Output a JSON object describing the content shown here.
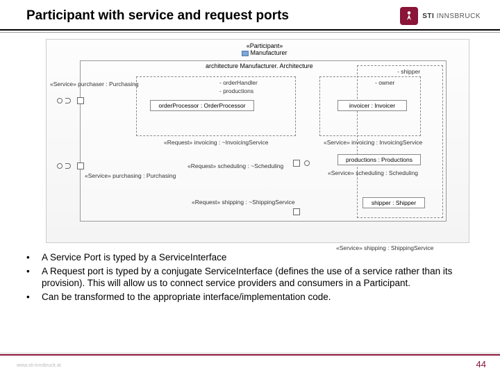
{
  "title": "Participant with service and request ports",
  "logo": {
    "brand": "STI",
    "sub": "INNSBRUCK"
  },
  "diagram": {
    "participant_stereo": "«Participant»",
    "participant_name": "Manufacturer",
    "architecture_label": "architecture   Manufacturer. Architecture",
    "left_service_top": "«Service» purchaser : Purchasing",
    "orderProcessor": "orderProcessor : OrderProcessor",
    "orderHandler": "- orderHandler",
    "productions_attr": "- productions",
    "owner_attr": "- owner",
    "shipper_attr": "- shipper",
    "invoicer": "invoicer : Invoicer",
    "req_invoicing": "«Request» invoicing : ~InvoicingService",
    "service_invoicing": "«Service» invoicing : InvoicingService",
    "left_service_bottom": "«Service» purchasing : Purchasing",
    "req_scheduling": "«Request» scheduling : ~Scheduling",
    "productions_box": "productions : Productions",
    "service_scheduling": "«Service» scheduling : Scheduling",
    "req_shipping": "«Request» shipping : ~ShippingService",
    "shipper_box": "shipper : Shipper",
    "service_shipping": "«Service» shipping : ShippingService"
  },
  "bullets": [
    "A Service Port is typed by a ServiceInterface",
    "A Request port is typed by a conjugate ServiceInterface (defines the use of a service rather than its provision).  This will allow us to connect service providers and consumers in a Participant.",
    "Can be transformed to the appropriate interface/implementation code."
  ],
  "page_number": "44",
  "copyright": "www.sti-innsbruck.at"
}
